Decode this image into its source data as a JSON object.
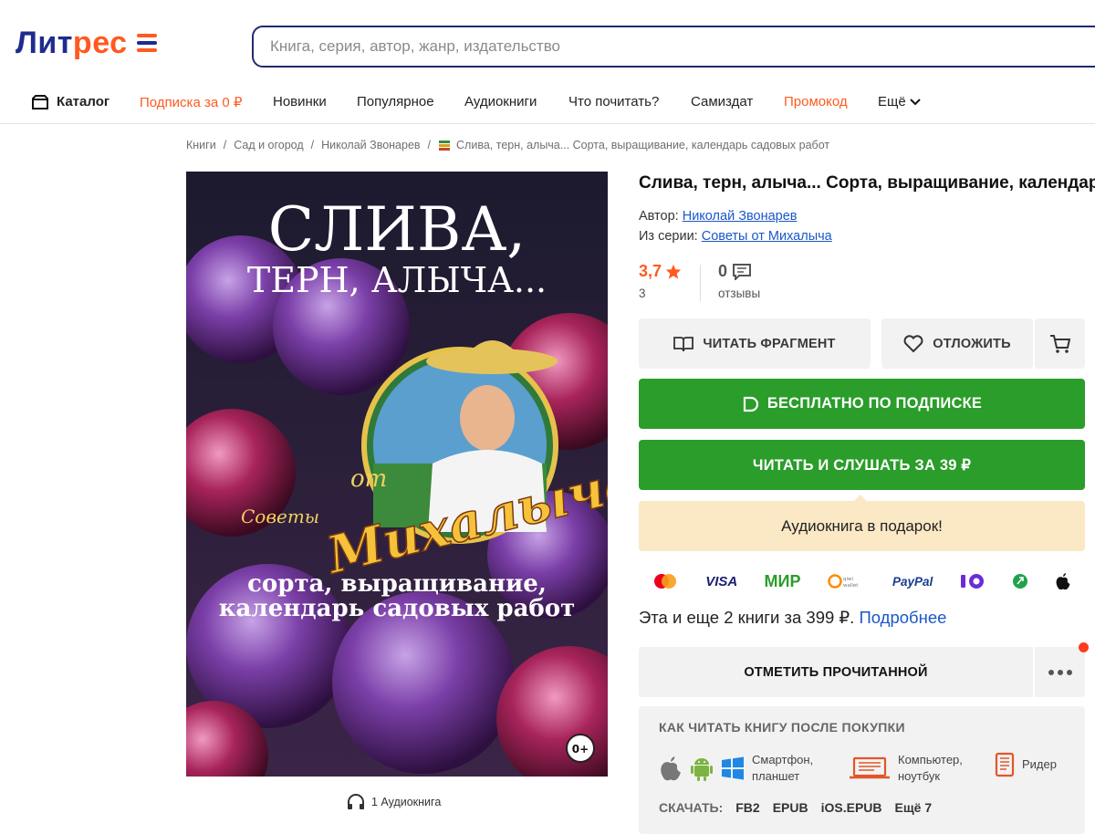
{
  "header": {
    "logo_part1": "Лит",
    "logo_part2": "рес",
    "search_placeholder": "Книга, серия, автор, жанр, издательство"
  },
  "nav": {
    "catalog": "Каталог",
    "items": [
      "Подписка за 0 ₽",
      "Новинки",
      "Популярное",
      "Аудиокниги",
      "Что почитать?",
      "Самиздат",
      "Промокод",
      "Ещё"
    ]
  },
  "breadcrumbs": [
    "Книги",
    "Сад и огород",
    "Николай Звонарев",
    "Слива, терн, алыча... Сорта, выращивание, календарь садовых работ"
  ],
  "cover": {
    "title_line1": "СЛИВА,",
    "title_line2": "ТЕРН, АЛЫЧА...",
    "series_small": "Советы",
    "series_ot": "от",
    "series_big": "Михалыча",
    "subtitle_line1": "сорта, выращивание,",
    "subtitle_line2": "календарь садовых работ",
    "age": "0+"
  },
  "audio_note": "1 Аудиокнига",
  "book": {
    "title": "Слива, терн, алыча... Сорта, выращивание, календарь садовых работ",
    "author_label": "Автор:",
    "author": "Николай Звонарев",
    "series_label": "Из серии:",
    "series": "Советы от Михалыча",
    "rating": "3,7",
    "rating_count": "3",
    "reviews": "0",
    "reviews_label": "отзывы"
  },
  "actions": {
    "read_fragment": "ЧИТАТЬ ФРАГМЕНТ",
    "postpone": "ОТЛОЖИТЬ",
    "free_subscription": "БЕСПЛАТНО ПО ПОДПИСКЕ",
    "buy": "ЧИТАТЬ И СЛУШАТЬ ЗА 39 ₽",
    "gift": "Аудиокнига в подарок!",
    "bundle_text": "Эта и еще 2 книги за 399 ₽.",
    "bundle_link": "Подробнее",
    "mark_read": "ОТМЕТИТЬ ПРОЧИТАННОЙ"
  },
  "payments": [
    "mastercard",
    "VISA",
    "МИР",
    "qiwi wallet",
    "PayPal",
    "ЮMoney",
    "green-pay",
    "Apple Pay"
  ],
  "howto": {
    "heading": "КАК ЧИТАТЬ КНИГУ ПОСЛЕ ПОКУПКИ",
    "phone_line1": "Смартфон,",
    "phone_line2": "планшет",
    "pc_line1": "Компьютер,",
    "pc_line2": "ноутбук",
    "reader": "Ридер",
    "download_label": "СКАЧАТЬ:",
    "formats": [
      "FB2",
      "EPUB",
      "iOS.EPUB",
      "Ещё 7"
    ]
  },
  "colors": {
    "brand_orange": "#ff5a1f",
    "brand_navy": "#1f2b8f",
    "green": "#2a9d2a",
    "link": "#1a58c8"
  }
}
